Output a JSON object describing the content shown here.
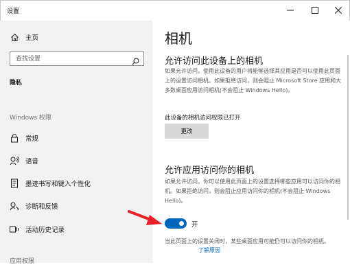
{
  "window": {
    "title": "设置",
    "buttons": [
      "minimize-icon",
      "maximize-icon",
      "close-icon"
    ]
  },
  "sidebar": {
    "home_label": "主页",
    "search_placeholder": "查找设置",
    "section_label": "隐私",
    "group_label": "Windows 权限",
    "items": [
      {
        "label": "常规",
        "icon": "lock-icon"
      },
      {
        "label": "语音",
        "icon": "voice-icon"
      },
      {
        "label": "墨迹书写和键入个性化",
        "icon": "inking-icon"
      },
      {
        "label": "诊断和反馈",
        "icon": "diagnostics-icon"
      },
      {
        "label": "活动历史记录",
        "icon": "activity-history-icon"
      }
    ],
    "partial_group_label": "应用权限"
  },
  "main": {
    "page_title": "相机",
    "section1": {
      "heading": "允许访问此设备上的相机",
      "description": "如果允许访问，使用此设备的用户将能够选择其应用是否可以使用此页面上的设置访问相机。如果拒绝访问，则会阻止 Microsoft Store 应用和大多数桌面应用访问相机(不会阻止 Windows Hello)。",
      "status": "此设备的相机访问权限已打开",
      "change_button": "更改"
    },
    "section2": {
      "heading": "允许应用访问你的相机",
      "description": "如果允许访问，你可以使用此页面上的设置选择哪些应用可以访问你的相机。如果拒绝访问，则会阻止应用访问你的相机(不会阻止 Windows Hello)。",
      "toggle_state": "on",
      "toggle_label": "开",
      "footnote": "当此页面上的设置关闭时，某些桌面应用可能仍可以访问你的相机。",
      "footnote_link": "了解原因"
    }
  },
  "colors": {
    "accent": "#0067c0",
    "sidebar_bg": "#f2f2f2",
    "annotation_arrow": "#e8202a"
  }
}
